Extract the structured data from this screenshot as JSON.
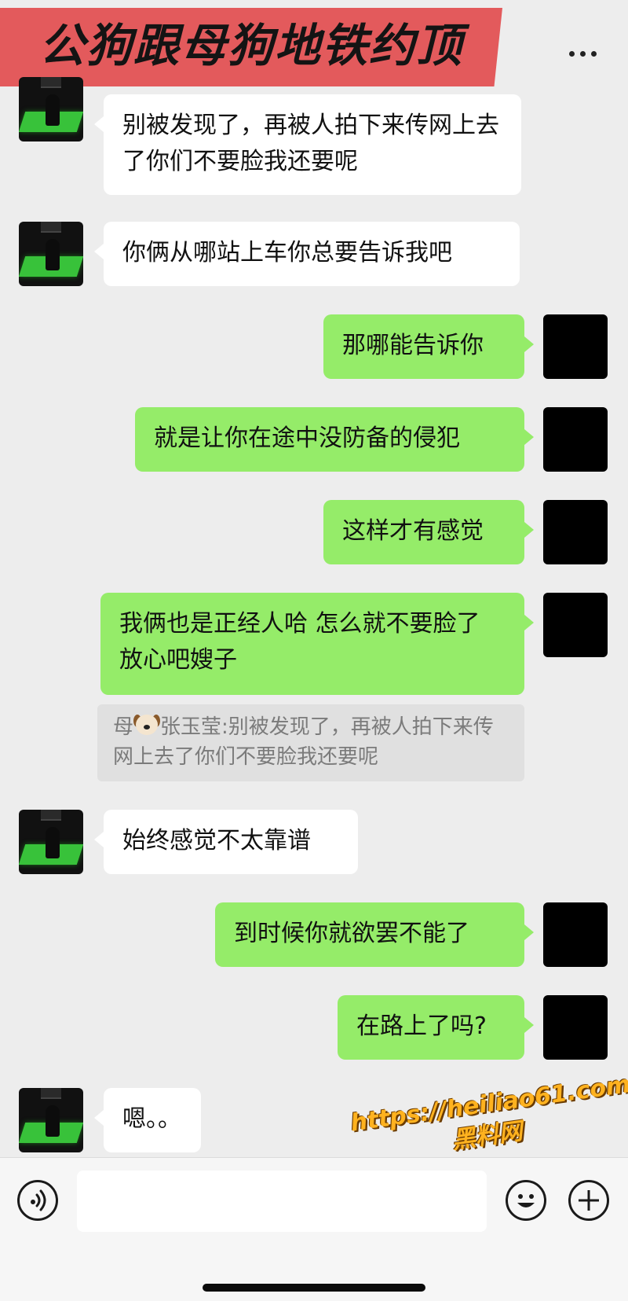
{
  "header": {
    "title": "公狗跟母狗地铁约顶",
    "more_icon": "more-dots-icon"
  },
  "messages": [
    {
      "side": "left",
      "text": "别被发现了，再被人拍下来传网上去了你们不要脸我还要呢"
    },
    {
      "side": "left",
      "text": "你俩从哪站上车你总要告诉我吧"
    },
    {
      "side": "right",
      "text": "那哪能告诉你"
    },
    {
      "side": "right",
      "text": "就是让你在途中没防备的侵犯"
    },
    {
      "side": "right",
      "text": "这样才有感觉"
    },
    {
      "side": "right",
      "text": "我俩也是正经人哈 怎么就不要脸了 放心吧嫂子"
    },
    {
      "side": "left",
      "text": "始终感觉不太靠谱"
    },
    {
      "side": "right",
      "text": "到时候你就欲罢不能了"
    },
    {
      "side": "right",
      "text": "在路上了吗?"
    },
    {
      "side": "left",
      "text": "嗯。。"
    }
  ],
  "quote": {
    "sender_prefix": "母",
    "sender_icon": "dog-face-emoji",
    "sender_name": "张玉莹:",
    "text": "别被发现了，再被人拍下来传网上去了你们不要脸我还要呢"
  },
  "watermark": {
    "url": "https://heiliao61.com",
    "site": "黑料网"
  },
  "input_bar": {
    "voice_icon": "voice-icon",
    "emoji_icon": "emoji-icon",
    "plus_icon": "plus-icon",
    "input_value": ""
  },
  "colors": {
    "background": "#ededed",
    "incoming_bubble": "#ffffff",
    "outgoing_bubble": "#95ec69",
    "title_banner": "#e35a5c",
    "watermark": "#ffb21f"
  }
}
